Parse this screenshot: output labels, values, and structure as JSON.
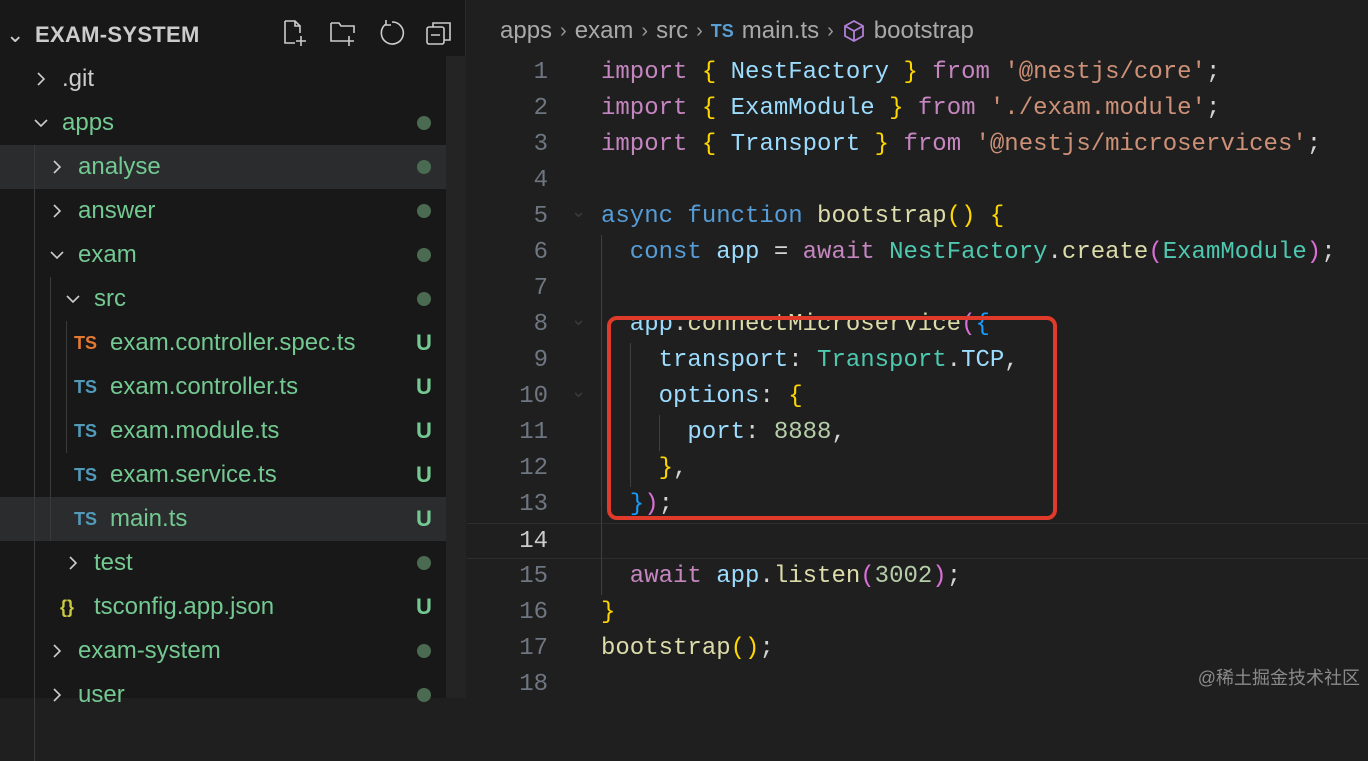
{
  "explorer": {
    "title": "EXAM-SYSTEM",
    "actions": [
      "new-file",
      "new-folder",
      "refresh",
      "collapse-all"
    ],
    "items": [
      {
        "label": ".git",
        "kind": "folder",
        "open": false,
        "depth": 0,
        "color": "#cccccc"
      },
      {
        "label": "apps",
        "kind": "folder",
        "open": true,
        "depth": 0,
        "color": "#73c991",
        "dot": true
      },
      {
        "label": "analyse",
        "kind": "folder",
        "open": false,
        "depth": 1,
        "color": "#73c991",
        "dot": true,
        "hover": true
      },
      {
        "label": "answer",
        "kind": "folder",
        "open": false,
        "depth": 1,
        "color": "#73c991",
        "dot": true
      },
      {
        "label": "exam",
        "kind": "folder",
        "open": true,
        "depth": 1,
        "color": "#73c991",
        "dot": true
      },
      {
        "label": "src",
        "kind": "folder",
        "open": true,
        "depth": 2,
        "color": "#73c991",
        "dot": true
      },
      {
        "label": "exam.controller.spec.ts",
        "kind": "ts",
        "icon": "TS",
        "iconColor": "#e37933",
        "depth": 3,
        "color": "#73c991",
        "status": "U"
      },
      {
        "label": "exam.controller.ts",
        "kind": "ts",
        "icon": "TS",
        "iconColor": "#519aba",
        "depth": 3,
        "color": "#73c991",
        "status": "U"
      },
      {
        "label": "exam.module.ts",
        "kind": "ts",
        "icon": "TS",
        "iconColor": "#519aba",
        "depth": 3,
        "color": "#73c991",
        "status": "U"
      },
      {
        "label": "exam.service.ts",
        "kind": "ts",
        "icon": "TS",
        "iconColor": "#519aba",
        "depth": 3,
        "color": "#73c991",
        "status": "U"
      },
      {
        "label": "main.ts",
        "kind": "ts",
        "icon": "TS",
        "iconColor": "#519aba",
        "depth": 3,
        "color": "#73c991",
        "status": "U",
        "selected": true
      },
      {
        "label": "test",
        "kind": "folder",
        "open": false,
        "depth": 2,
        "color": "#73c991",
        "dot": true
      },
      {
        "label": "tsconfig.app.json",
        "kind": "json",
        "icon": "{}",
        "iconColor": "#cbcb41",
        "depth": 2,
        "color": "#73c991",
        "status": "U"
      },
      {
        "label": "exam-system",
        "kind": "folder",
        "open": false,
        "depth": 1,
        "color": "#73c991",
        "dot": true
      },
      {
        "label": "user",
        "kind": "folder",
        "open": false,
        "depth": 1,
        "color": "#73c991",
        "dot": true
      }
    ]
  },
  "breadcrumb": {
    "parts": [
      "apps",
      "exam",
      "src"
    ],
    "file_icon": "TS",
    "file": "main.ts",
    "symbol": "bootstrap"
  },
  "code": {
    "current_line": 14,
    "lines": [
      {
        "n": "1",
        "fold": false,
        "tokens": [
          [
            "import ",
            "kw2"
          ],
          [
            "{ ",
            "b1"
          ],
          [
            "NestFactory",
            "id"
          ],
          [
            " } ",
            "b1"
          ],
          [
            "from ",
            "kw2"
          ],
          [
            "'@nestjs/core'",
            "str"
          ],
          [
            ";",
            "p"
          ]
        ]
      },
      {
        "n": "2",
        "tokens": [
          [
            "import ",
            "kw2"
          ],
          [
            "{ ",
            "b1"
          ],
          [
            "ExamModule",
            "id"
          ],
          [
            " } ",
            "b1"
          ],
          [
            "from ",
            "kw2"
          ],
          [
            "'./exam.module'",
            "str"
          ],
          [
            ";",
            "p"
          ]
        ]
      },
      {
        "n": "3",
        "tokens": [
          [
            "import ",
            "kw2"
          ],
          [
            "{ ",
            "b1"
          ],
          [
            "Transport",
            "id"
          ],
          [
            " } ",
            "b1"
          ],
          [
            "from ",
            "kw2"
          ],
          [
            "'@nestjs/microservices'",
            "str"
          ],
          [
            ";",
            "p"
          ]
        ]
      },
      {
        "n": "4",
        "tokens": []
      },
      {
        "n": "5",
        "fold": true,
        "tokens": [
          [
            "async ",
            "kw"
          ],
          [
            "function ",
            "kw"
          ],
          [
            "bootstrap",
            "fn"
          ],
          [
            "() ",
            "b1"
          ],
          [
            "{",
            "b1"
          ]
        ]
      },
      {
        "n": "6",
        "tokens": [
          [
            "  const ",
            "kw"
          ],
          [
            "app",
            "id"
          ],
          [
            " = ",
            "p"
          ],
          [
            "await ",
            "kw2"
          ],
          [
            "NestFactory",
            "cls"
          ],
          [
            ".",
            "p"
          ],
          [
            "create",
            "fn"
          ],
          [
            "(",
            "b2"
          ],
          [
            "ExamModule",
            "cls"
          ],
          [
            ")",
            "b2"
          ],
          [
            ";",
            "p"
          ]
        ]
      },
      {
        "n": "7",
        "tokens": []
      },
      {
        "n": "8",
        "fold": true,
        "tokens": [
          [
            "  app",
            "id"
          ],
          [
            ".",
            "p"
          ],
          [
            "connectMicroservice",
            "fn"
          ],
          [
            "(",
            "b2"
          ],
          [
            "{",
            "b3"
          ]
        ]
      },
      {
        "n": "9",
        "tokens": [
          [
            "    transport",
            "id"
          ],
          [
            ": ",
            "p"
          ],
          [
            "Transport",
            "cls"
          ],
          [
            ".",
            "p"
          ],
          [
            "TCP",
            "id"
          ],
          [
            ",",
            "p"
          ]
        ]
      },
      {
        "n": "10",
        "fold": true,
        "tokens": [
          [
            "    options",
            "id"
          ],
          [
            ": ",
            "p"
          ],
          [
            "{",
            "b1"
          ]
        ]
      },
      {
        "n": "11",
        "tokens": [
          [
            "      port",
            "id"
          ],
          [
            ": ",
            "p"
          ],
          [
            "8888",
            "num"
          ],
          [
            ",",
            "p"
          ]
        ]
      },
      {
        "n": "12",
        "tokens": [
          [
            "    }",
            "b1"
          ],
          [
            ",",
            "p"
          ]
        ]
      },
      {
        "n": "13",
        "tokens": [
          [
            "  }",
            "b3"
          ],
          [
            ")",
            "b2"
          ],
          [
            ";",
            "p"
          ]
        ]
      },
      {
        "n": "14",
        "tokens": []
      },
      {
        "n": "15",
        "tokens": [
          [
            "  await ",
            "kw2"
          ],
          [
            "app",
            "id"
          ],
          [
            ".",
            "p"
          ],
          [
            "listen",
            "fn"
          ],
          [
            "(",
            "b2"
          ],
          [
            "3002",
            "num"
          ],
          [
            ")",
            "b2"
          ],
          [
            ";",
            "p"
          ]
        ]
      },
      {
        "n": "16",
        "tokens": [
          [
            "}",
            "b1"
          ]
        ]
      },
      {
        "n": "17",
        "tokens": [
          [
            "bootstrap",
            "fn"
          ],
          [
            "()",
            "b1"
          ],
          [
            ";",
            "p"
          ]
        ]
      },
      {
        "n": "18",
        "tokens": []
      }
    ]
  },
  "watermark": "@稀土掘金技术社区"
}
